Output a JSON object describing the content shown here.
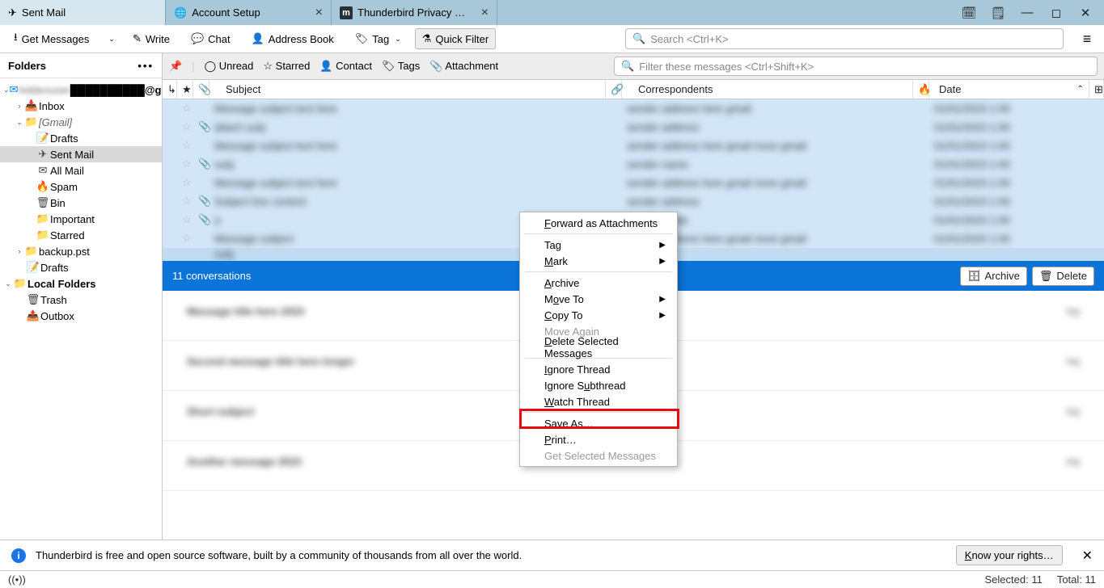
{
  "tabs": [
    {
      "label": "Sent Mail",
      "icon": "send"
    },
    {
      "label": "Account Setup",
      "icon": "globe"
    },
    {
      "label": "Thunderbird Privacy Notice",
      "icon": "m"
    }
  ],
  "toolbar": {
    "getmsg": "Get Messages",
    "write": "Write",
    "chat": "Chat",
    "address": "Address Book",
    "tag": "Tag",
    "quickfilter": "Quick Filter",
    "search_placeholder": "Search <Ctrl+K>"
  },
  "sidebar": {
    "header": "Folders",
    "account": "██████████@gmail.com",
    "inbox": "Inbox",
    "gmail": "[Gmail]",
    "drafts": "Drafts",
    "sent": "Sent Mail",
    "all": "All Mail",
    "spam": "Spam",
    "bin": "Bin",
    "important": "Important",
    "starred": "Starred",
    "backup": "backup.pst",
    "drafts2": "Drafts",
    "local": "Local Folders",
    "trash": "Trash",
    "outbox": "Outbox"
  },
  "qf": {
    "unread": "Unread",
    "starred": "Starred",
    "contact": "Contact",
    "tags": "Tags",
    "attachment": "Attachment",
    "filter_placeholder": "Filter these messages <Ctrl+Shift+K>"
  },
  "cols": {
    "subject": "Subject",
    "corr": "Correspondents",
    "date": "Date"
  },
  "convbar": {
    "title": "11 conversations",
    "archive": "Archive",
    "delete": "Delete"
  },
  "ctx": {
    "forward": "Forward as Attachments",
    "tag": "Tag",
    "mark": "Mark",
    "archive": "Archive",
    "move": "Move To",
    "copy": "Copy To",
    "moveagain": "Move Again",
    "delete": "Delete Selected Messages",
    "ignore": "Ignore Thread",
    "ignoresub": "Ignore Subthread",
    "watch": "Watch Thread",
    "save": "Save As…",
    "print": "Print…",
    "getsel": "Get Selected Messages"
  },
  "notice": {
    "text": "Thunderbird is free and open source software, built by a community of thousands from all over the world.",
    "btn": "Know your rights…"
  },
  "status": {
    "selected": "Selected: 11",
    "total": "Total: 11"
  }
}
